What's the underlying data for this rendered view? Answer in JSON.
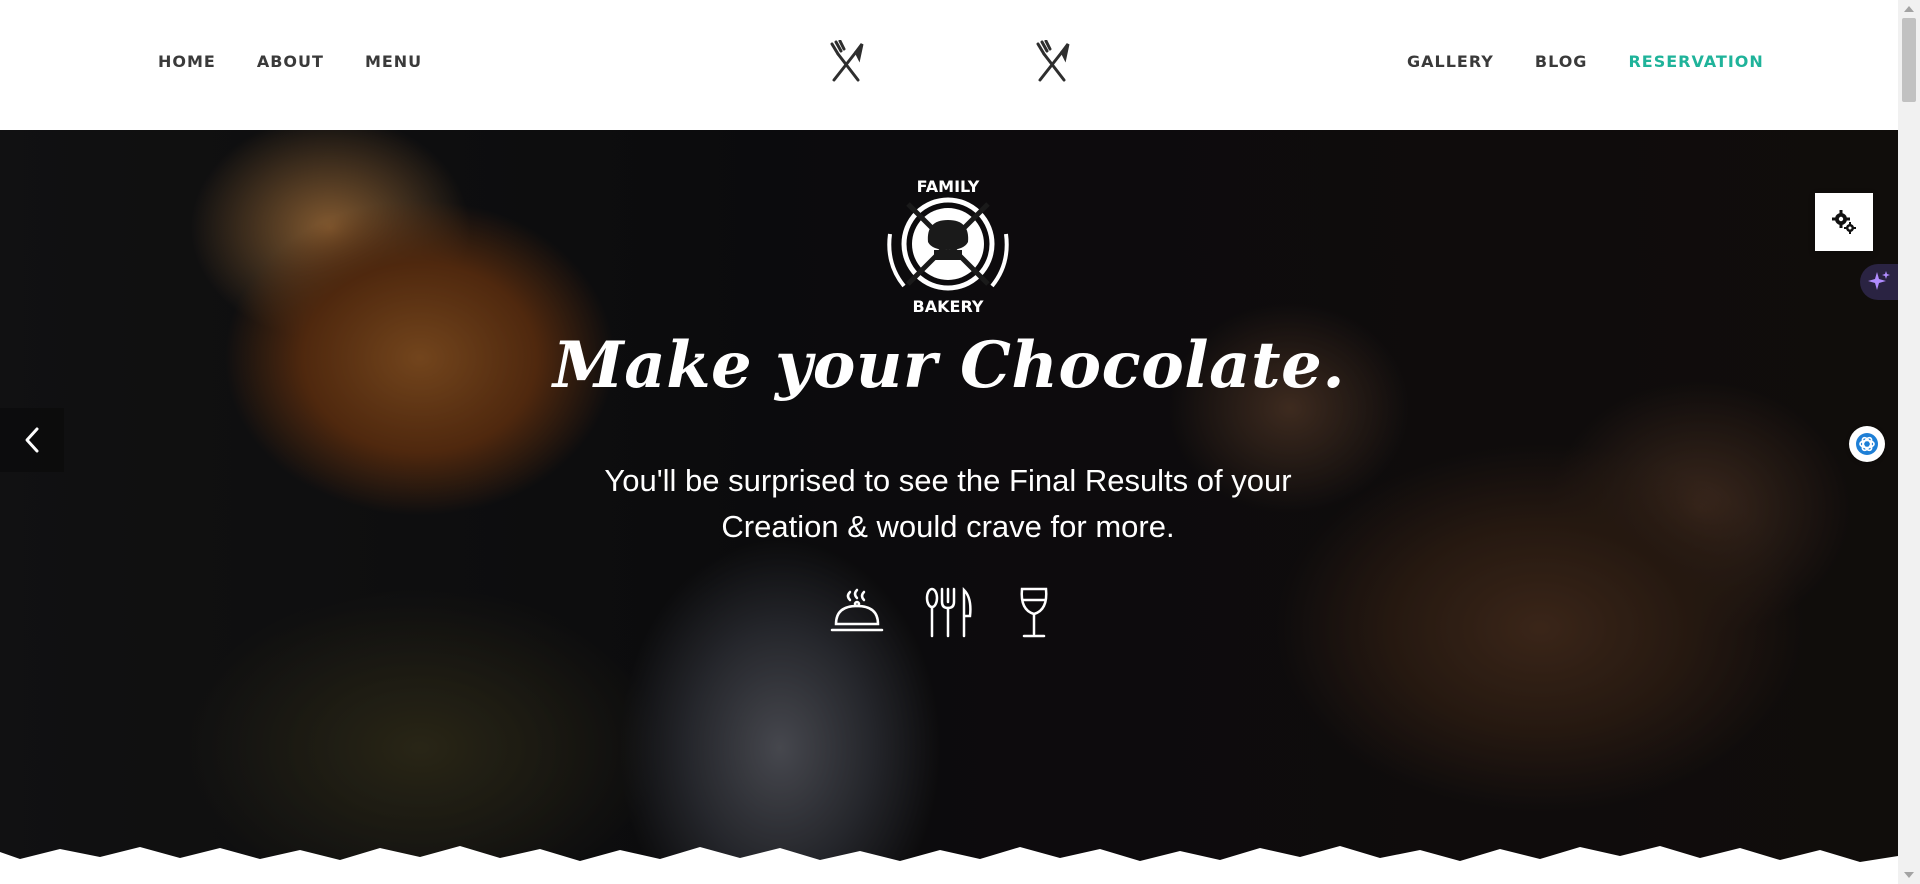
{
  "nav": {
    "left": [
      "HOME",
      "ABOUT",
      "MENU"
    ],
    "right": [
      "GALLERY",
      "BLOG",
      "RESERVATION"
    ],
    "active": "RESERVATION",
    "active_color": "#1fb39a"
  },
  "header": {
    "logo_icon": "crossed-fork-knife-icon"
  },
  "hero": {
    "emblem_top": "FAMILY",
    "emblem_bottom": "BAKERY",
    "title": "Make your Chocolate.",
    "subtitle": "You'll be surprised to see the Final Results of your Creation & would crave for more.",
    "icons": [
      "cloche-icon",
      "fork-spoon-knife-icon",
      "wine-glass-icon"
    ]
  },
  "widgets": {
    "settings_icon": "gear-icon",
    "sparkle_icon": "sparkle-icon",
    "assistant_icon": "assistant-icon"
  },
  "slider": {
    "prev_icon": "chevron-left-icon"
  }
}
